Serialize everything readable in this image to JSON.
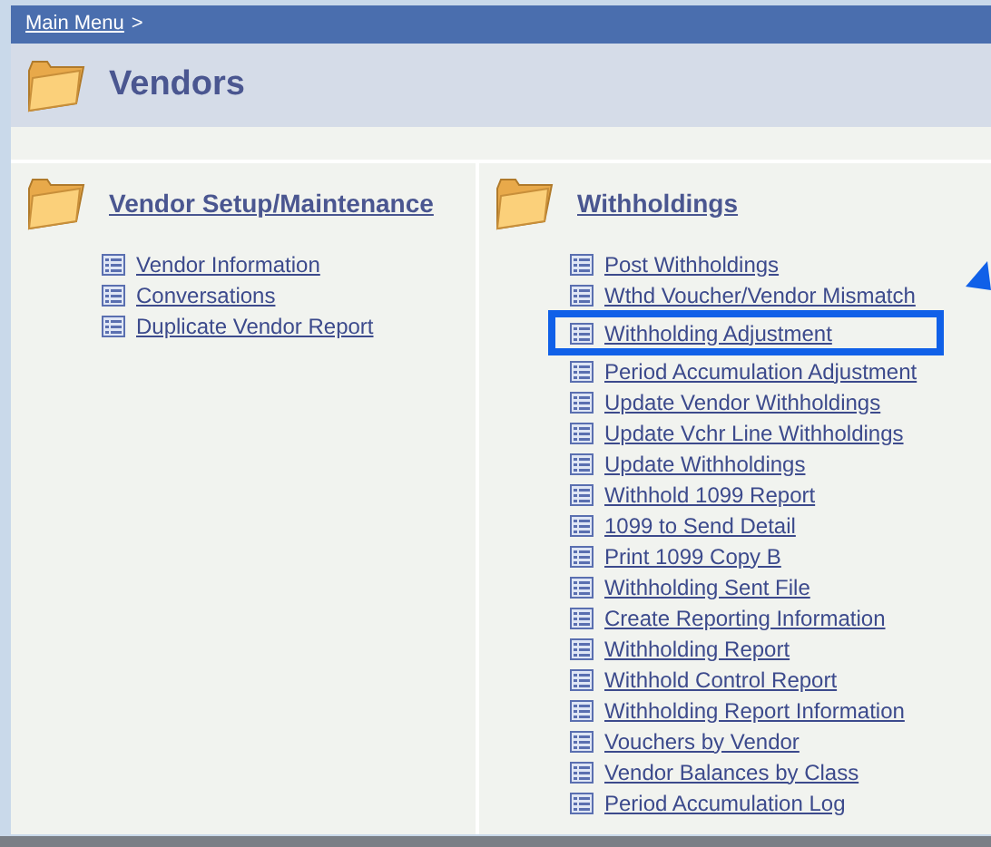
{
  "breadcrumb": {
    "link": "Main Menu",
    "separator": ">"
  },
  "title": "Vendors",
  "sections": [
    {
      "title": "Vendor Setup/Maintenance",
      "items": [
        {
          "label": "Vendor Information",
          "highlighted": false
        },
        {
          "label": "Conversations",
          "highlighted": false
        },
        {
          "label": "Duplicate Vendor Report",
          "highlighted": false
        }
      ]
    },
    {
      "title": "Withholdings",
      "items": [
        {
          "label": "Post Withholdings",
          "highlighted": false
        },
        {
          "label": "Wthd Voucher/Vendor Mismatch",
          "highlighted": false
        },
        {
          "label": "Withholding Adjustment",
          "highlighted": true
        },
        {
          "label": "Period Accumulation Adjustment",
          "highlighted": false
        },
        {
          "label": "Update Vendor Withholdings",
          "highlighted": false
        },
        {
          "label": "Update Vchr Line Withholdings",
          "highlighted": false
        },
        {
          "label": "Update Withholdings",
          "highlighted": false
        },
        {
          "label": "Withhold 1099 Report",
          "highlighted": false
        },
        {
          "label": "1099 to Send Detail",
          "highlighted": false
        },
        {
          "label": "Print 1099 Copy B",
          "highlighted": false
        },
        {
          "label": "Withholding Sent File",
          "highlighted": false
        },
        {
          "label": "Create Reporting Information",
          "highlighted": false
        },
        {
          "label": "Withholding Report",
          "highlighted": false
        },
        {
          "label": "Withhold Control Report",
          "highlighted": false
        },
        {
          "label": "Withholding Report Information",
          "highlighted": false
        },
        {
          "label": "Vouchers by Vendor",
          "highlighted": false
        },
        {
          "label": "Vendor Balances by Class",
          "highlighted": false
        },
        {
          "label": "Period Accumulation Log",
          "highlighted": false
        }
      ]
    }
  ]
}
